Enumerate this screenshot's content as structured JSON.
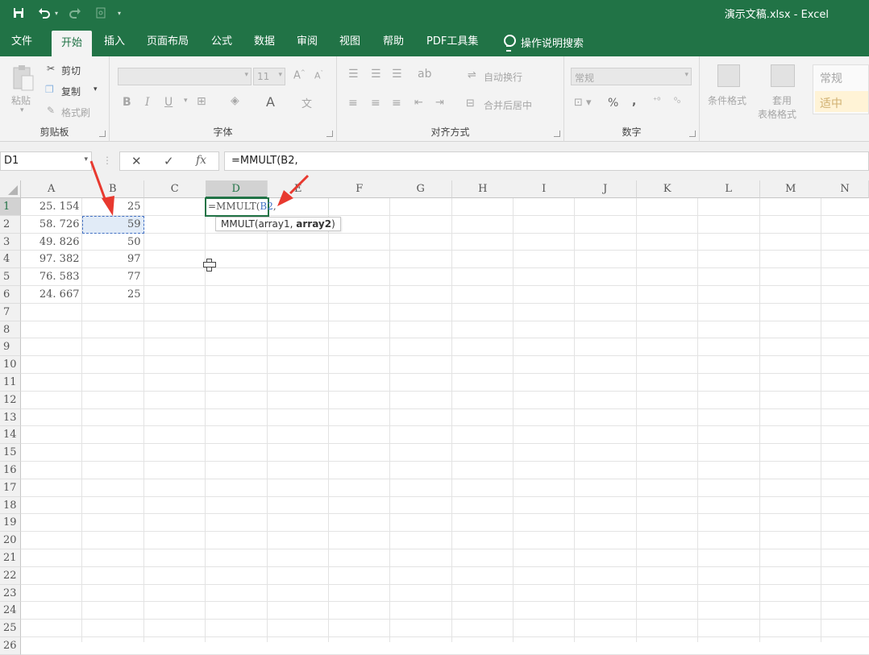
{
  "window": {
    "title": "演示文稿.xlsx  -  Excel",
    "quick_access": [
      "save-icon",
      "undo-icon",
      "redo-icon",
      "print-preview-icon",
      "customize-icon"
    ]
  },
  "tabs": [
    "文件",
    "开始",
    "插入",
    "页面布局",
    "公式",
    "数据",
    "审阅",
    "视图",
    "帮助",
    "PDF工具集"
  ],
  "active_tab": "开始",
  "tell_me": "操作说明搜索",
  "ribbon": {
    "clipboard": {
      "label": "剪贴板",
      "paste": "粘贴",
      "cut": "剪切",
      "copy": "复制",
      "format_painter": "格式刷"
    },
    "font": {
      "label": "字体",
      "font_size": "11",
      "bold": "B",
      "italic": "I",
      "underline": "U"
    },
    "alignment": {
      "label": "对齐方式",
      "wrap_text": "自动换行",
      "merge_center": "合并后居中"
    },
    "number": {
      "label": "数字",
      "format": "常规",
      "percent": "%",
      "comma": ","
    },
    "styles": {
      "conditional_format": "条件格式",
      "format_table_1": "套用",
      "format_table_2": "表格格式",
      "style_normal": "常规",
      "style_neutral": "适中"
    }
  },
  "formula_bar": {
    "name_box": "D1",
    "cancel": "✕",
    "enter": "✓",
    "fx": "fx",
    "formula": "=MMULT(B2,"
  },
  "columns": [
    "A",
    "B",
    "C",
    "D",
    "E",
    "F",
    "G",
    "H",
    "I",
    "J",
    "K",
    "L",
    "M",
    "N"
  ],
  "rows": [
    "1",
    "2",
    "3",
    "4",
    "5",
    "6",
    "7",
    "8",
    "9",
    "10",
    "11",
    "12",
    "13",
    "14",
    "15",
    "16",
    "17",
    "18",
    "19",
    "20",
    "21",
    "22",
    "23",
    "24",
    "25",
    "26"
  ],
  "cells": {
    "A": [
      "25. 154",
      "58. 726",
      "49. 826",
      "97. 382",
      "76. 583",
      "24. 667"
    ],
    "B": [
      "25",
      "59",
      "50",
      "97",
      "77",
      "25"
    ]
  },
  "editing": {
    "cell": "D1",
    "prefix": "=MMULT(",
    "ref": "B2",
    "suffix": ",",
    "tooltip_pre": "MMULT(array1, ",
    "tooltip_bold": "array2",
    "tooltip_post": ")"
  },
  "colors": {
    "brand": "#217346",
    "arrow": "#e8392f",
    "ref": "#4472c4"
  }
}
